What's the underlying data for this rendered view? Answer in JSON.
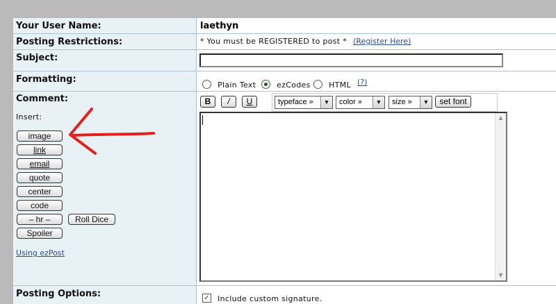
{
  "username_row": {
    "label": "Your User Name:",
    "value": "laethyn"
  },
  "restrictions_row": {
    "label": "Posting Restrictions:",
    "text": "* You must be REGISTERED to post *",
    "link": "(Register Here)"
  },
  "subject_row": {
    "label": "Subject:",
    "value": ""
  },
  "formatting_row": {
    "label": "Formatting:",
    "options": [
      {
        "label": "Plain Text",
        "selected": false
      },
      {
        "label": "ezCodes",
        "selected": true
      },
      {
        "label": "HTML",
        "selected": false
      }
    ],
    "help_link": "(?)"
  },
  "comment_row": {
    "label": "Comment:",
    "insert_label": "Insert:",
    "insert_buttons": {
      "image": "image",
      "link": "link",
      "email": "email",
      "quote": "quote",
      "center": "center",
      "code": "code",
      "hr": "– hr –",
      "roll_dice": "Roll Dice",
      "spoiler": "Spoiler"
    },
    "help_link": "Using ezPost",
    "toolbar": {
      "bold": "B",
      "italic": "/",
      "underline": "U",
      "typeface": "typeface »",
      "color": "color »",
      "size": "size »",
      "set_font": "set font"
    },
    "body": ""
  },
  "options_row": {
    "label": "Posting Options:",
    "signature": {
      "label": "Include custom signature.",
      "checked": true
    }
  },
  "colors": {
    "label_bg": "#e8f1f5",
    "border": "#a9c3cf",
    "link": "#2b4c8c",
    "annotation_arrow": "#e3201b"
  }
}
